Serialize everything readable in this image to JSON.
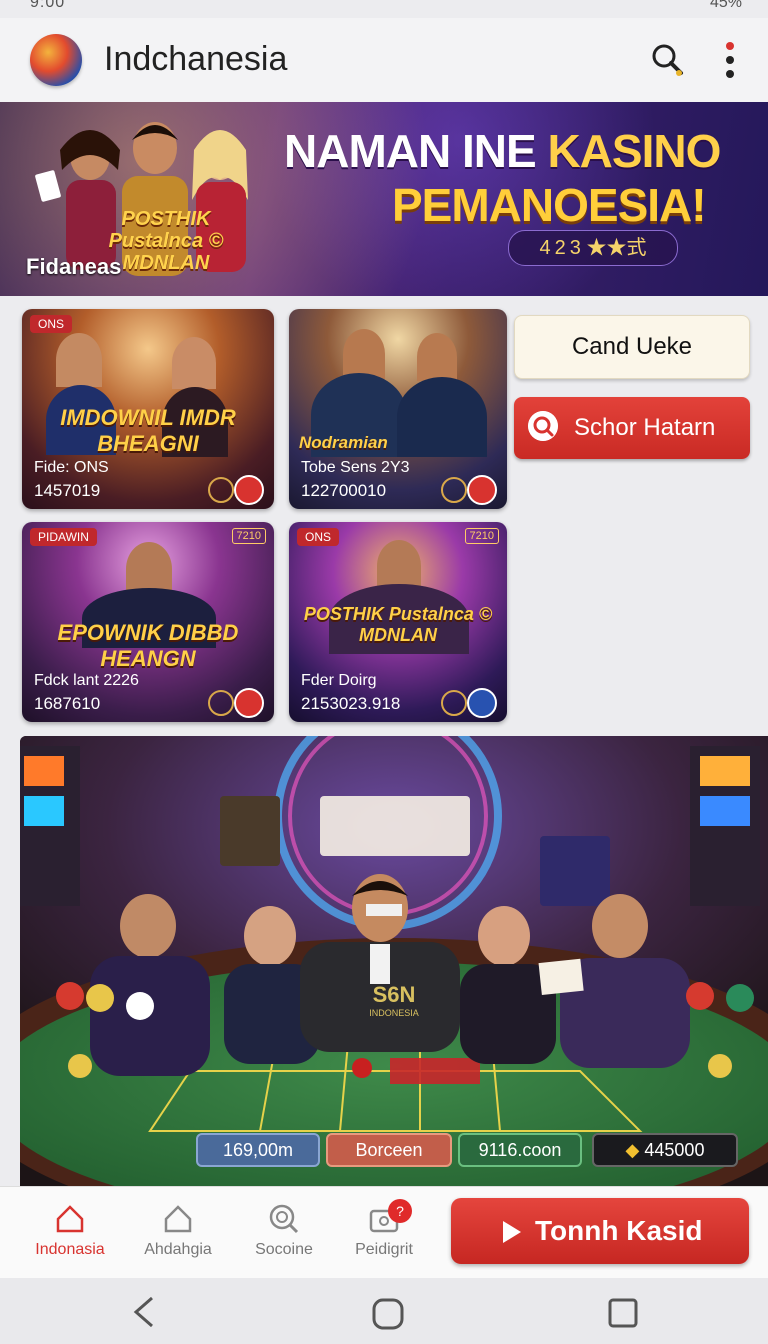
{
  "status": {
    "time": "9:00",
    "battery": "45%"
  },
  "appbar": {
    "title": "Indchanesia",
    "search_icon": "search-icon",
    "more_icon": "more-vert-icon"
  },
  "banner": {
    "headline_white": "NAMAN INE",
    "headline_gold": "KASINO",
    "headline_line2": "PEMANOESIA!",
    "rating": "4 2 3 ★★式",
    "brand": "Fidaneas",
    "badge": "POSTHIK Pustalnca © MDNLAN"
  },
  "cards": [
    {
      "title": "IMDOWNIL IMDR BHEAGNI",
      "caption": "Fide: ONS",
      "value": "1457019",
      "tag": "ONS",
      "tag_right": ""
    },
    {
      "title": "Nodramian",
      "caption": "Tobe Sens 2Y3",
      "value": "122700010",
      "tag": "",
      "tag_right": ""
    },
    {
      "title": "EPOWNIK DIBBD HEANGN",
      "caption": "Fdck lant 2226",
      "value": "1687610",
      "tag": "PIDAWIN",
      "tag_right": "7210"
    },
    {
      "title": "POSTHIK Pustalnca © MDNLAN",
      "caption": "Fder Doirg",
      "value": "2153023.918",
      "tag": "ONS",
      "tag_right": "7210"
    }
  ],
  "side_buttons": {
    "cream": "Cand Ueke",
    "red": "Schor Hatarn"
  },
  "hero": {
    "table_text": "S6N",
    "table_sub": "INDONESIA",
    "stats": [
      "169,00m",
      "Borceen",
      "9116.coon",
      "445000"
    ]
  },
  "bottom_nav": [
    {
      "label": "Indonasia",
      "icon": "home-icon",
      "active": true
    },
    {
      "label": "Ahdahgia",
      "icon": "house-outline-icon",
      "active": false
    },
    {
      "label": "Socoine",
      "icon": "search-circle-icon",
      "active": false
    },
    {
      "label": "Peidigrit",
      "icon": "wallet-icon",
      "active": false,
      "badge": "?"
    }
  ],
  "cta": {
    "label": "Tonnh Kasid"
  },
  "colors": {
    "accent_red": "#d8332f",
    "gold": "#ffd04a",
    "banner_purple": "#3a1f6a"
  }
}
